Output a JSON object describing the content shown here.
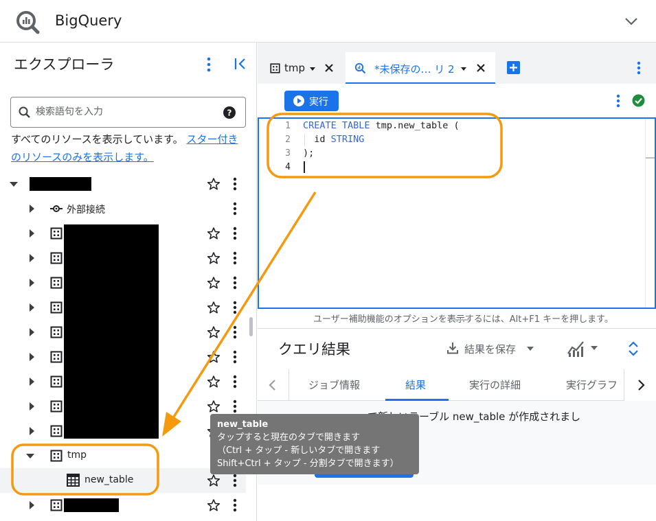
{
  "header": {
    "app_title": "BigQuery"
  },
  "explorer": {
    "title": "エクスプローラ",
    "search_placeholder": "検索語句を入力",
    "resource_note": "すべてのリソースを表示しています。",
    "starred_link": "スター付きのリソースのみを表示します。",
    "external_connection_label": "外部接続",
    "dataset_label": "tmp",
    "table_label": "new_table"
  },
  "tabs": [
    {
      "label": "tmp"
    },
    {
      "label": "*未保存の… リ 2"
    }
  ],
  "editor": {
    "run_label": "実行",
    "lines": [
      {
        "num": "1",
        "kw1": "CREATE TABLE",
        "rest": " tmp.new_table ("
      },
      {
        "num": "2",
        "pre": "  id ",
        "kw": "STRING"
      },
      {
        "num": "3",
        "text": ");"
      },
      {
        "num": "4",
        "text": ""
      }
    ],
    "a11y_hint": "ユーザー補助機能のオプションを表示するには、Alt+F1 キーを押します。"
  },
  "results": {
    "title": "クエリ結果",
    "save_label": "結果を保存",
    "tabs": [
      "ジョブ情報",
      "結果",
      "実行の詳細",
      "実行グラフ"
    ],
    "message": "で新しいテーブル new_table が作成されまし"
  },
  "tooltip": {
    "title": "new_table",
    "line1": "タップすると現在のタブで開きます",
    "line2": "（Ctrl + タップ - 新しいタブで開きます",
    "line3": "Shift+Ctrl + タップ - 分割タブで開きます）"
  },
  "colors": {
    "accent": "#1a73e8",
    "annotation": "#f5990f",
    "success": "#1e8e3e"
  },
  "icons": [
    "bigquery-logo-icon",
    "chevron-down-icon",
    "kebab-icon",
    "collapse-panel-icon",
    "search-icon",
    "help-icon",
    "star-icon",
    "table-icon",
    "connection-icon",
    "close-icon",
    "query-icon",
    "add-tab-icon",
    "play-icon",
    "check-circle-icon",
    "download-icon",
    "chart-icon",
    "expand-icon",
    "chevron-left-icon",
    "chevron-right-icon"
  ]
}
